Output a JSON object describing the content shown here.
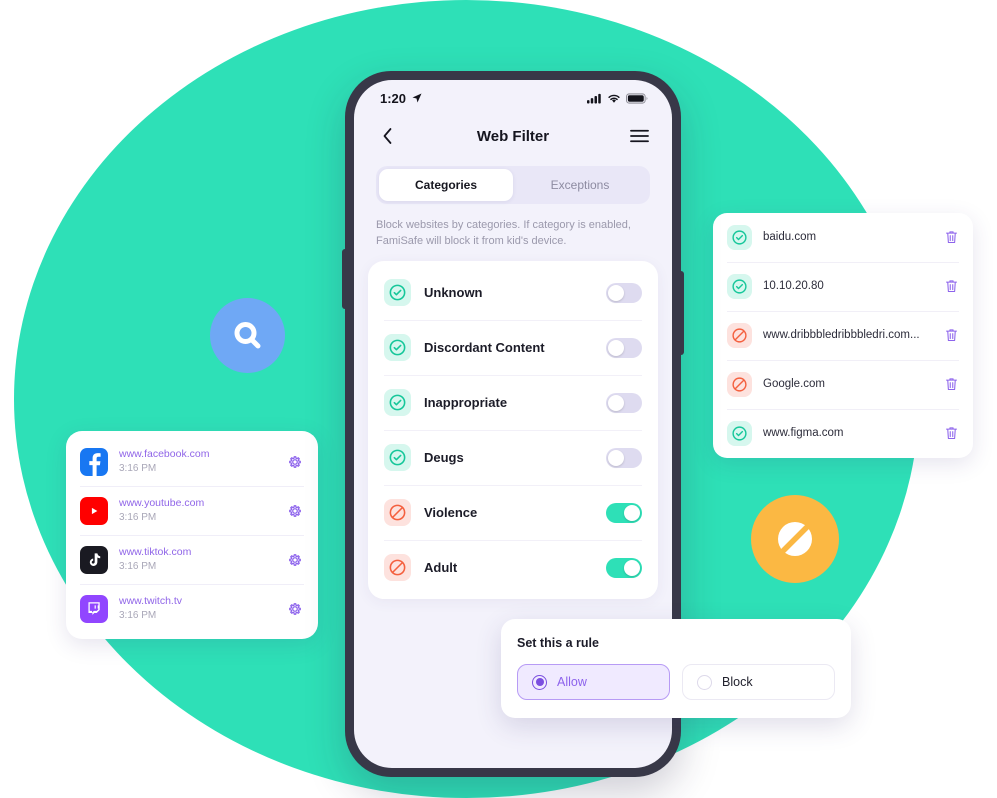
{
  "colors": {
    "teal": "#2ee0b7",
    "purple": "#7b4fe0",
    "orange": "#fbb843",
    "blue": "#6fa8f5",
    "phone_frame": "#383848",
    "screen_bg": "#f3f2fb",
    "allow_icon_bg": "#d6f7ee",
    "block_icon_bg": "#fde2de",
    "block_icon": "#f4603f"
  },
  "badges": {
    "search": "search-icon",
    "block": "no-entry-icon"
  },
  "phone": {
    "status_bar": {
      "time": "1:20",
      "location_icon": "location-arrow-icon",
      "signal_icon": "cellular-signal-icon",
      "wifi_icon": "wifi-icon",
      "battery_icon": "battery-full-icon"
    },
    "nav": {
      "back_icon": "chevron-left-icon",
      "title": "Web Filter",
      "menu_icon": "hamburger-menu-icon"
    },
    "tabs": [
      {
        "label": "Categories",
        "active": true
      },
      {
        "label": "Exceptions",
        "active": false
      }
    ],
    "description": "Block websites by categories. If category is enabled, FamiSafe will block it from kid's device.",
    "categories": [
      {
        "label": "Unknown",
        "icon": "check-circle-icon",
        "status": "allow",
        "enabled": false
      },
      {
        "label": "Discordant Content",
        "icon": "check-circle-icon",
        "status": "allow",
        "enabled": false
      },
      {
        "label": "Inappropriate",
        "icon": "check-circle-icon",
        "status": "allow",
        "enabled": false
      },
      {
        "label": "Deugs",
        "icon": "check-circle-icon",
        "status": "allow",
        "enabled": false
      },
      {
        "label": "Violence",
        "icon": "no-entry-icon",
        "status": "block",
        "enabled": true
      },
      {
        "label": "Adult",
        "icon": "no-entry-icon",
        "status": "block",
        "enabled": true
      }
    ]
  },
  "exceptions_card": {
    "rows": [
      {
        "label": "baidu.com",
        "icon": "check-circle-icon",
        "status": "allow",
        "delete_icon": "trash-icon"
      },
      {
        "label": "10.10.20.80",
        "icon": "check-circle-icon",
        "status": "allow",
        "delete_icon": "trash-icon"
      },
      {
        "label": "www.dribbbledribbbledri.com...",
        "icon": "no-entry-icon",
        "status": "block",
        "delete_icon": "trash-icon"
      },
      {
        "label": "Google.com",
        "icon": "no-entry-icon",
        "status": "block",
        "delete_icon": "trash-icon"
      },
      {
        "label": "www.figma.com",
        "icon": "check-circle-icon",
        "status": "allow",
        "delete_icon": "trash-icon"
      }
    ]
  },
  "sites_card": {
    "rows": [
      {
        "url": "www.facebook.com",
        "time": "3:16 PM",
        "logo": "facebook-logo-icon",
        "settings_icon": "gear-icon"
      },
      {
        "url": "www.youtube.com",
        "time": "3:16 PM",
        "logo": "youtube-logo-icon",
        "settings_icon": "gear-icon"
      },
      {
        "url": "www.tiktok.com",
        "time": "3:16 PM",
        "logo": "tiktok-logo-icon",
        "settings_icon": "gear-icon"
      },
      {
        "url": "www.twitch.tv",
        "time": "3:16 PM",
        "logo": "twitch-logo-icon",
        "settings_icon": "gear-icon"
      }
    ]
  },
  "rule_popup": {
    "title": "Set this a rule",
    "options": [
      {
        "label": "Allow",
        "selected": true
      },
      {
        "label": "Block",
        "selected": false
      }
    ]
  }
}
